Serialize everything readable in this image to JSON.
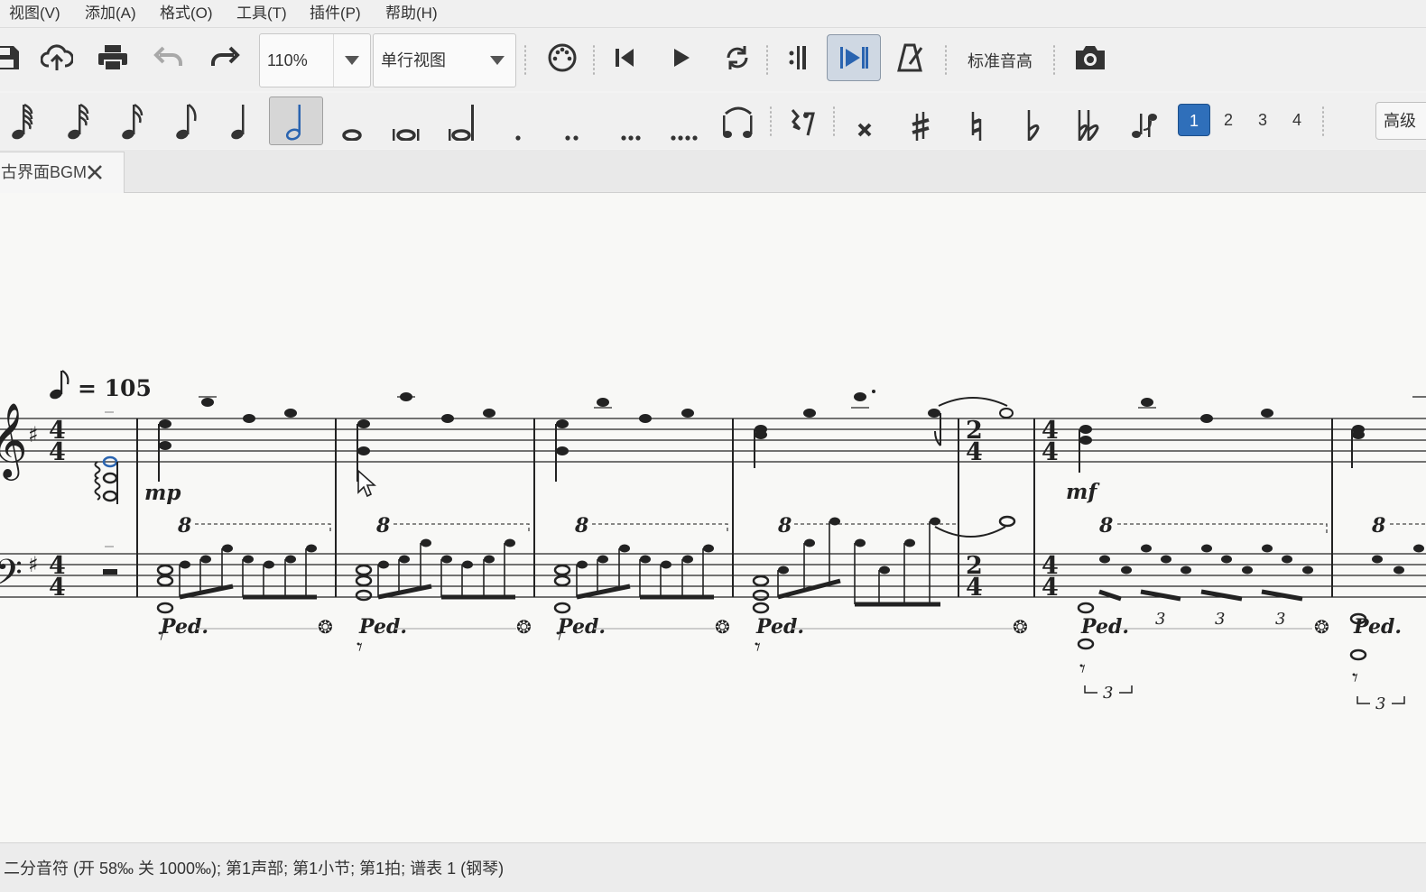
{
  "menu": [
    "视图(V)",
    "添加(A)",
    "格式(O)",
    "工具(T)",
    "插件(P)",
    "帮助(H)"
  ],
  "toolbar": {
    "zoom_value": "110%",
    "view_mode": "单行视图",
    "concert_pitch_label": "标准音高",
    "icons": [
      "save-icon",
      "cloud-upload-icon",
      "print-icon",
      "undo-icon",
      "redo-icon",
      "midi-input-icon",
      "rewind-icon",
      "play-icon",
      "loop-icon",
      "loop-in-icon",
      "pan-score-icon",
      "metronome-icon",
      "camera-icon"
    ]
  },
  "note_input": {
    "durations": [
      "64th",
      "32nd",
      "16th",
      "eighth",
      "quarter",
      "half",
      "whole",
      "breve",
      "longa"
    ],
    "dots": [
      ".",
      "..",
      "...",
      "...."
    ],
    "accidentals": [
      "double-sharp",
      "sharp",
      "natural",
      "flat",
      "double-flat"
    ],
    "voices": [
      "1",
      "2",
      "3",
      "4"
    ],
    "active_voice": "1",
    "active_duration": "half",
    "advanced_label": "高级"
  },
  "tab": {
    "title": "古界面BGM",
    "close_glyph": "✕"
  },
  "score": {
    "tempo_text": "= 105",
    "dynamics": [
      "mp",
      "mf"
    ],
    "octave_marks": [
      "8",
      "8",
      "8",
      "8",
      "8",
      "8"
    ],
    "pedal_text": "Ped.",
    "tuplet_numbers": [
      "3",
      "3",
      "3",
      "3",
      "3"
    ],
    "time_signatures": {
      "initial": "4/4",
      "change": "2/4",
      "back": "4/4"
    },
    "key_signature": "1 sharp (G major)"
  },
  "status": {
    "text": "二分音符 (开 58‰ 关 1000‰); 第1声部;  第1小节; 第1拍; 谱表 1 (钢琴)"
  },
  "colors": {
    "accent": "#2f6fba",
    "selected_note": "#2a64b0"
  }
}
